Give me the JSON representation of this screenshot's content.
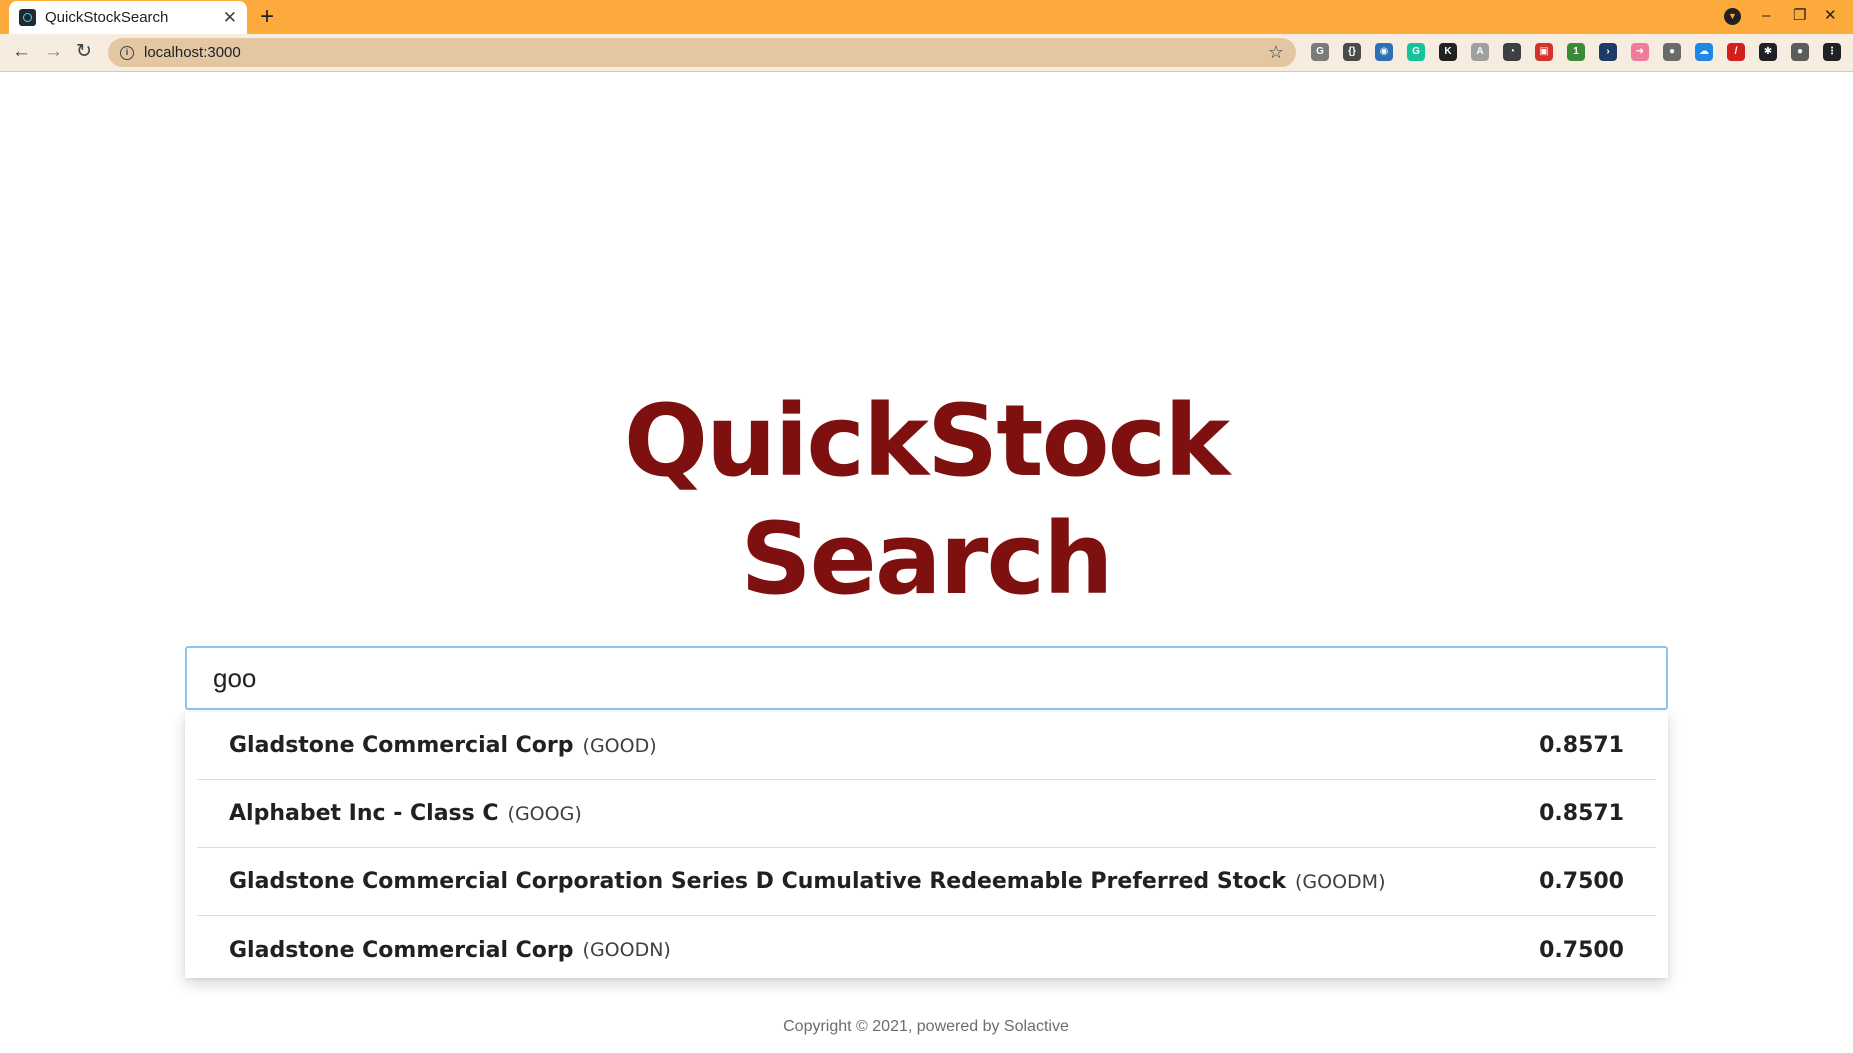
{
  "browser": {
    "tab_title": "QuickStockSearch",
    "tab_close": "✕",
    "new_tab": "+",
    "url": "localhost:3000",
    "window_controls": {
      "minimize": "–",
      "restore": "❐",
      "close": "✕"
    },
    "accent": "#fdaa3d"
  },
  "extensions": [
    {
      "name": "grammarly-g-icon",
      "glyph": "G",
      "color": "#7b7b7b"
    },
    {
      "name": "braces-icon",
      "glyph": "{}",
      "color": "#4a4a4a"
    },
    {
      "name": "person-icon",
      "glyph": "◉",
      "color": "#2f6fb5"
    },
    {
      "name": "grammarly-icon",
      "glyph": "G",
      "color": "#15c39a"
    },
    {
      "name": "k-icon",
      "glyph": "K",
      "color": "#222222"
    },
    {
      "name": "puzzle-grey-icon",
      "glyph": "A",
      "color": "#a0a0a0"
    },
    {
      "name": "timer-icon",
      "glyph": "◔",
      "color": "#3c4043"
    },
    {
      "name": "red-box-icon",
      "glyph": "▣",
      "color": "#d4332a"
    },
    {
      "name": "notify-icon",
      "glyph": "1",
      "color": "#3a8a3a"
    },
    {
      "name": "terminal-icon",
      "glyph": "›",
      "color": "#1e3a66"
    },
    {
      "name": "pink-arrow-icon",
      "glyph": "➜",
      "color": "#f07b9a"
    },
    {
      "name": "grey-circle-icon",
      "glyph": "●",
      "color": "#6a6a6a"
    },
    {
      "name": "cloud-icon",
      "glyph": "☁",
      "color": "#1e88e5"
    },
    {
      "name": "pen-icon",
      "glyph": "/",
      "color": "#d41f1f"
    },
    {
      "name": "extensions-icon",
      "glyph": "✱",
      "color": "#202124"
    },
    {
      "name": "avatar",
      "glyph": "●",
      "color": "#5b5b5b"
    },
    {
      "name": "menu-icon",
      "glyph": "⋮",
      "color": "#202124"
    }
  ],
  "page": {
    "title_line1": "QuickStock",
    "title_line2": "Search",
    "title_color": "#7e1010",
    "footer": "Copyright © 2021, powered by Solactive"
  },
  "search": {
    "value": "goo",
    "placeholder": ""
  },
  "results": [
    {
      "name": "Gladstone Commercial Corp",
      "symbol": "(GOOD)",
      "score": "0.8571"
    },
    {
      "name": "Alphabet Inc - Class C",
      "symbol": "(GOOG)",
      "score": "0.8571"
    },
    {
      "name": "Gladstone Commercial Corporation Series D Cumulative Redeemable Preferred Stock",
      "symbol": "(GOODM)",
      "score": "0.7500"
    },
    {
      "name": "Gladstone Commercial Corp",
      "symbol": "(GOODN)",
      "score": "0.7500"
    }
  ]
}
